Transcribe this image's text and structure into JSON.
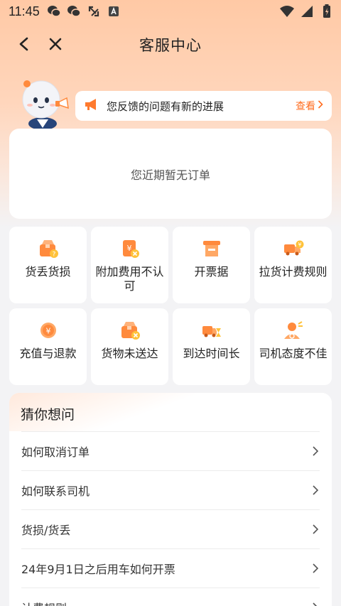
{
  "status_bar": {
    "time": "11:45",
    "left_icons": [
      "wechat-icon",
      "wechat-icon",
      "sync-icon",
      "a-box-icon"
    ],
    "right_icons": [
      "wifi-icon",
      "signal-icon",
      "battery-icon"
    ]
  },
  "nav": {
    "title": "客服中心"
  },
  "notice": {
    "text": "您反馈的问题有新的进展",
    "link": "查看"
  },
  "order_card": {
    "empty_text": "您近期暂无订单"
  },
  "services": [
    {
      "label": "货丢货损",
      "icon": "box-question-icon"
    },
    {
      "label": "附加费用不认可",
      "icon": "invoice-reject-icon"
    },
    {
      "label": "开票据",
      "icon": "receipt-icon"
    },
    {
      "label": "拉货计费规则",
      "icon": "truck-fee-icon"
    },
    {
      "label": "充值与退款",
      "icon": "yuan-coin-icon"
    },
    {
      "label": "货物未送达",
      "icon": "box-cross-icon"
    },
    {
      "label": "到达时间长",
      "icon": "truck-hourglass-icon"
    },
    {
      "label": "司机态度不佳",
      "icon": "driver-icon"
    }
  ],
  "faq": {
    "title": "猜你想问",
    "items": [
      "如何取消订单",
      "如何联系司机",
      "货损/货丢",
      "24年9月1日之后用车如何开票",
      "计费规则"
    ]
  },
  "colors": {
    "accent": "#ff6d20",
    "icon_orange": "#ff8a3d",
    "header_gradient": "#ffc9a5"
  }
}
